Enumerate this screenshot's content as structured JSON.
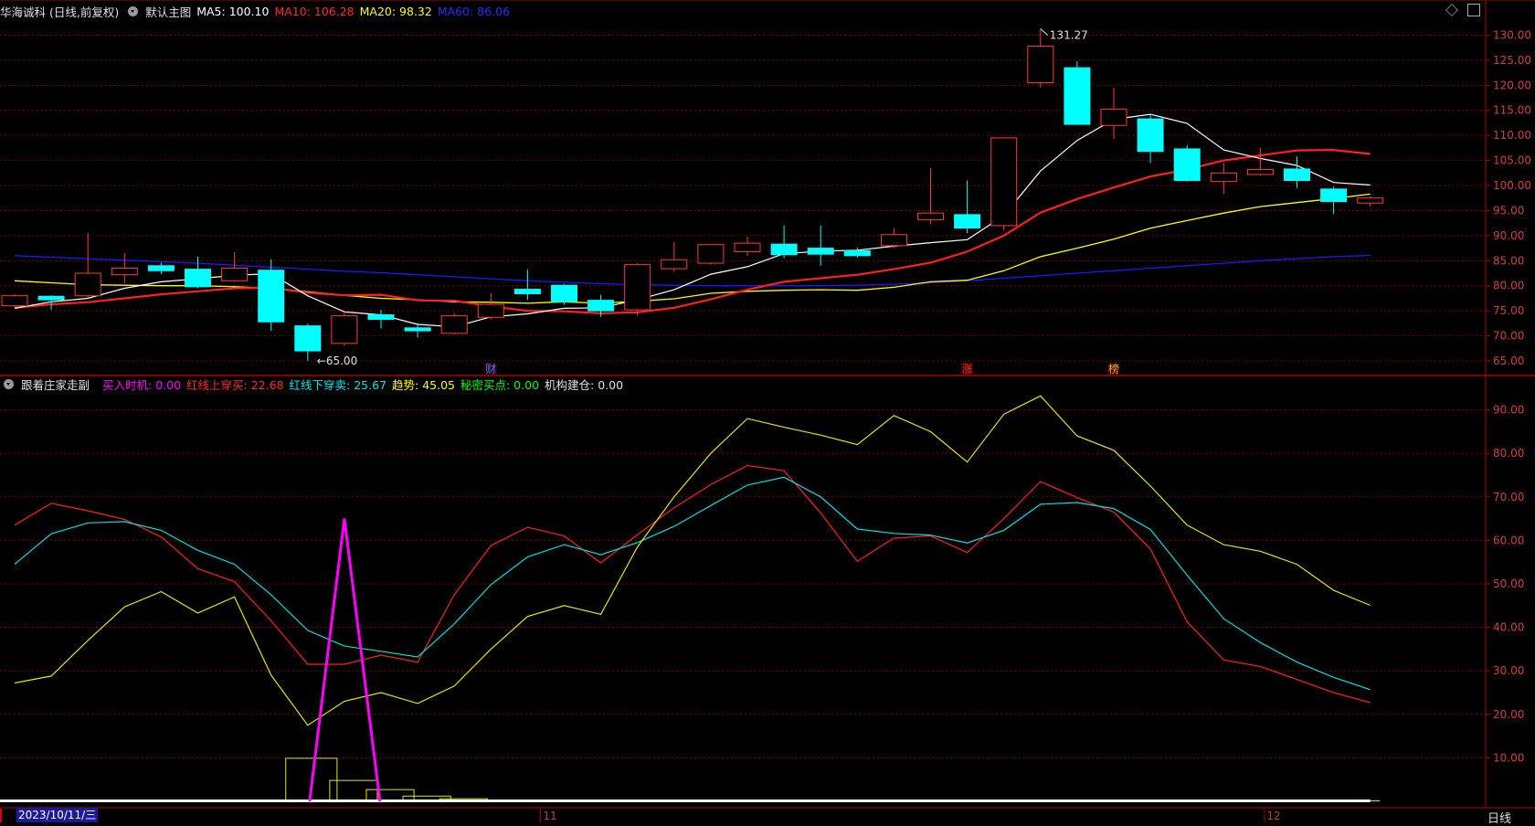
{
  "header_top": {
    "stock_title": "华海诚科 (日线,前复权)",
    "indicator_name": "默认主图",
    "ma5": "MA5: 100.10",
    "ma10": "MA10: 106.28",
    "ma20": "MA20: 98.32",
    "ma60": "MA60: 86.06"
  },
  "header_bottom": {
    "indicator_name": "跟着庄家走副",
    "buy_timing": "买入时机: 0.00",
    "red_up": "红线上穿买: 22.68",
    "red_down": "红线下穿卖: 25.67",
    "trend": "趋势: 45.05",
    "secret_buy": "秘密买点: 0.00",
    "inst_build": "机构建仓: 0.00"
  },
  "colors": {
    "ma5": "#ffffff",
    "ma10": "#ff2020",
    "ma20": "#ffff00",
    "ma60": "#1a1aff",
    "up": "#ff3b3b",
    "down": "#00ffff",
    "grid": "#7a0000",
    "axis": "#b00000",
    "buy": "#ff00ff",
    "trend": "#e6e600",
    "red": "#ff2020",
    "cyan": "#00e0e0"
  },
  "footer": {
    "date_label": "2023/10/11/三",
    "month_11": "11",
    "month_12": "12",
    "period": "日线"
  },
  "icons": [
    "gear-icon",
    "diamond-icon",
    "square-icon"
  ],
  "chart_data": [
    {
      "type": "candlestick",
      "title": "华海诚科 (日线,前复权)",
      "ylim": [
        63,
        133
      ],
      "yticks": [
        "130.00",
        "125.00",
        "120.00",
        "115.00",
        "110.00",
        "105.00",
        "100.00",
        "95.00",
        "90.00",
        "85.00",
        "80.00",
        "75.00",
        "70.00",
        "65.00"
      ],
      "ytick_values": [
        130,
        125,
        120,
        115,
        110,
        105,
        100,
        95,
        90,
        85,
        80,
        75,
        70,
        65
      ],
      "annotations": [
        {
          "text": "131.27",
          "index": 28,
          "value": 131.27,
          "side": "high"
        },
        {
          "text": "←65.00",
          "index": 8,
          "value": 65.0,
          "side": "low"
        }
      ],
      "markers": [
        {
          "text": "财",
          "index": 13,
          "color": "#4a7aff"
        },
        {
          "text": "涨",
          "index": 26,
          "color": "#ff3030"
        },
        {
          "text": "榜",
          "index": 30,
          "color": "#ffb000"
        }
      ],
      "candles": [
        {
          "o": 76.0,
          "h": 78.4,
          "l": 75.8,
          "c": 78.0
        },
        {
          "o": 77.9,
          "h": 78.1,
          "l": 75.2,
          "c": 77.2
        },
        {
          "o": 78.0,
          "h": 90.5,
          "l": 77.5,
          "c": 82.5
        },
        {
          "o": 82.2,
          "h": 86.5,
          "l": 80.5,
          "c": 83.5
        },
        {
          "o": 84.0,
          "h": 84.6,
          "l": 82.3,
          "c": 83.0
        },
        {
          "o": 83.3,
          "h": 85.8,
          "l": 79.5,
          "c": 79.8
        },
        {
          "o": 81.0,
          "h": 86.7,
          "l": 80.8,
          "c": 83.5
        },
        {
          "o": 83.1,
          "h": 85.3,
          "l": 71.0,
          "c": 72.8
        },
        {
          "o": 72.0,
          "h": 72.4,
          "l": 65.0,
          "c": 67.0
        },
        {
          "o": 68.5,
          "h": 74.6,
          "l": 68.0,
          "c": 74.0
        },
        {
          "o": 74.2,
          "h": 75.2,
          "l": 71.5,
          "c": 73.3
        },
        {
          "o": 71.6,
          "h": 72.5,
          "l": 69.7,
          "c": 71.0
        },
        {
          "o": 70.5,
          "h": 74.5,
          "l": 70.3,
          "c": 74.0
        },
        {
          "o": 73.7,
          "h": 78.5,
          "l": 73.3,
          "c": 76.3
        },
        {
          "o": 79.3,
          "h": 83.2,
          "l": 77.2,
          "c": 78.4
        },
        {
          "o": 80.1,
          "h": 80.3,
          "l": 76.2,
          "c": 76.8
        },
        {
          "o": 77.1,
          "h": 78.2,
          "l": 73.8,
          "c": 75.0
        },
        {
          "o": 75.2,
          "h": 84.5,
          "l": 74.0,
          "c": 84.2
        },
        {
          "o": 83.4,
          "h": 88.7,
          "l": 82.8,
          "c": 85.2
        },
        {
          "o": 84.5,
          "h": 88.3,
          "l": 84.2,
          "c": 88.2
        },
        {
          "o": 86.8,
          "h": 89.8,
          "l": 86.0,
          "c": 88.5
        },
        {
          "o": 88.3,
          "h": 92.0,
          "l": 85.5,
          "c": 86.2
        },
        {
          "o": 87.5,
          "h": 92.0,
          "l": 84.0,
          "c": 86.3
        },
        {
          "o": 87.0,
          "h": 87.6,
          "l": 85.6,
          "c": 86.0
        },
        {
          "o": 88.0,
          "h": 91.5,
          "l": 87.5,
          "c": 90.2
        },
        {
          "o": 93.2,
          "h": 103.5,
          "l": 92.3,
          "c": 94.5
        },
        {
          "o": 94.2,
          "h": 101.0,
          "l": 90.5,
          "c": 91.5
        },
        {
          "o": 92.0,
          "h": 109.5,
          "l": 91.0,
          "c": 109.5
        },
        {
          "o": 120.5,
          "h": 131.27,
          "l": 119.5,
          "c": 127.8
        },
        {
          "o": 123.5,
          "h": 124.8,
          "l": 112.2,
          "c": 112.2
        },
        {
          "o": 112.0,
          "h": 119.5,
          "l": 109.3,
          "c": 115.2
        },
        {
          "o": 113.3,
          "h": 114.2,
          "l": 104.5,
          "c": 106.8
        },
        {
          "o": 107.3,
          "h": 108.0,
          "l": 100.8,
          "c": 101.0
        },
        {
          "o": 100.8,
          "h": 104.5,
          "l": 98.3,
          "c": 102.5
        },
        {
          "o": 102.2,
          "h": 107.5,
          "l": 102.0,
          "c": 103.2
        },
        {
          "o": 103.3,
          "h": 105.8,
          "l": 99.5,
          "c": 101.0
        },
        {
          "o": 99.3,
          "h": 99.8,
          "l": 94.3,
          "c": 96.8
        },
        {
          "o": 96.5,
          "h": 97.8,
          "l": 95.8,
          "c": 97.5
        }
      ],
      "series": [
        {
          "name": "MA5",
          "values": [
            75.5,
            76.8,
            77.5,
            79.5,
            80.8,
            81.4,
            82.1,
            82.4,
            78.0,
            74.8,
            74.2,
            72.3,
            71.8,
            73.8,
            74.4,
            75.5,
            75.6,
            77.2,
            79.2,
            82.3,
            83.8,
            86.4,
            86.9,
            87.1,
            87.9,
            88.6,
            89.2,
            94.0,
            102.9,
            109.0,
            113.2,
            114.2,
            112.4,
            107.1,
            105.4,
            104.0,
            100.6,
            100.1
          ]
        },
        {
          "name": "MA10",
          "values": [
            75.6,
            76.3,
            76.7,
            77.5,
            78.3,
            78.9,
            79.5,
            79.6,
            78.6,
            78.1,
            78.2,
            77.1,
            77.0,
            75.9,
            75.0,
            74.9,
            74.5,
            74.7,
            75.6,
            77.3,
            79.2,
            80.8,
            81.5,
            82.2,
            83.3,
            84.6,
            86.8,
            90.0,
            94.6,
            97.3,
            99.6,
            101.8,
            103.2,
            105.0,
            106.0,
            107.0,
            107.1,
            106.3
          ]
        },
        {
          "name": "MA20",
          "values": [
            81.0,
            80.6,
            80.2,
            80.1,
            80.0,
            80.0,
            79.8,
            79.5,
            78.8,
            78.1,
            77.5,
            77.2,
            76.8,
            76.7,
            76.5,
            76.8,
            76.5,
            76.9,
            77.4,
            78.5,
            78.9,
            79.1,
            79.2,
            79.1,
            79.7,
            80.8,
            81.1,
            83.0,
            85.8,
            87.5,
            89.3,
            91.5,
            93.0,
            94.5,
            95.8,
            96.6,
            97.4,
            98.3
          ]
        },
        {
          "name": "MA60",
          "values": [
            86.0,
            85.7,
            85.4,
            85.1,
            84.8,
            84.5,
            84.1,
            83.7,
            83.3,
            82.9,
            82.6,
            82.2,
            81.8,
            81.4,
            81.0,
            80.7,
            80.4,
            80.2,
            80.1,
            80.0,
            80.0,
            80.0,
            80.0,
            80.1,
            80.3,
            80.6,
            81.0,
            81.5,
            82.0,
            82.5,
            83.0,
            83.5,
            84.0,
            84.5,
            85.0,
            85.4,
            85.8,
            86.06
          ]
        }
      ]
    },
    {
      "type": "line",
      "title": "跟着庄家走副",
      "ylim": [
        0,
        96
      ],
      "yticks": [
        "90.00",
        "80.00",
        "70.00",
        "60.00",
        "50.00",
        "40.00",
        "30.00",
        "20.00",
        "10.00"
      ],
      "ytick_values": [
        90,
        80,
        70,
        60,
        50,
        40,
        30,
        20,
        10
      ],
      "series": [
        {
          "name": "红线上穿买",
          "values": [
            63.5,
            68.5,
            66.8,
            64.8,
            60.8,
            53.5,
            50.5,
            41.5,
            31.5,
            31.5,
            33.6,
            32.0,
            47.5,
            58.8,
            63.0,
            61.0,
            54.8,
            61.3,
            67.5,
            72.8,
            77.2,
            76.0,
            66.3,
            55.2,
            60.5,
            61.0,
            57.2,
            65.0,
            73.5,
            69.8,
            66.5,
            58.0,
            41.3,
            32.5,
            31.0,
            28.0,
            25.0,
            22.68
          ]
        },
        {
          "name": "红线下穿卖",
          "values": [
            54.5,
            61.5,
            64.0,
            64.3,
            62.3,
            57.7,
            54.5,
            47.5,
            39.3,
            35.7,
            34.5,
            33.2,
            40.8,
            49.8,
            56.2,
            59.0,
            56.7,
            59.5,
            63.2,
            68.0,
            72.7,
            74.5,
            70.0,
            62.6,
            61.6,
            61.2,
            59.4,
            62.3,
            68.3,
            68.7,
            67.3,
            62.5,
            52.0,
            42.0,
            36.5,
            32.0,
            28.5,
            25.67
          ]
        },
        {
          "name": "趋势",
          "values": [
            27.2,
            28.8,
            37.0,
            44.7,
            48.2,
            43.3,
            47.0,
            29.0,
            17.5,
            23.0,
            25.0,
            22.5,
            26.5,
            35.0,
            42.5,
            45.0,
            43.0,
            58.5,
            70.0,
            80.0,
            88.0,
            86.0,
            84.2,
            82.0,
            88.7,
            85.0,
            78.0,
            89.0,
            93.2,
            84.0,
            80.7,
            72.5,
            63.5,
            59.0,
            57.5,
            54.5,
            48.5,
            45.05
          ]
        }
      ],
      "buy_timing_spike": {
        "index": 9,
        "value": 65.0
      },
      "bars": [
        {
          "start": 7.4,
          "end": 8.8,
          "value": 9.9
        },
        {
          "start": 8.6,
          "end": 9.9,
          "value": 4.8
        },
        {
          "start": 9.6,
          "end": 10.9,
          "value": 2.7
        },
        {
          "start": 10.6,
          "end": 11.9,
          "value": 1.2
        },
        {
          "start": 11.6,
          "end": 12.9,
          "value": 0.6
        }
      ]
    }
  ]
}
